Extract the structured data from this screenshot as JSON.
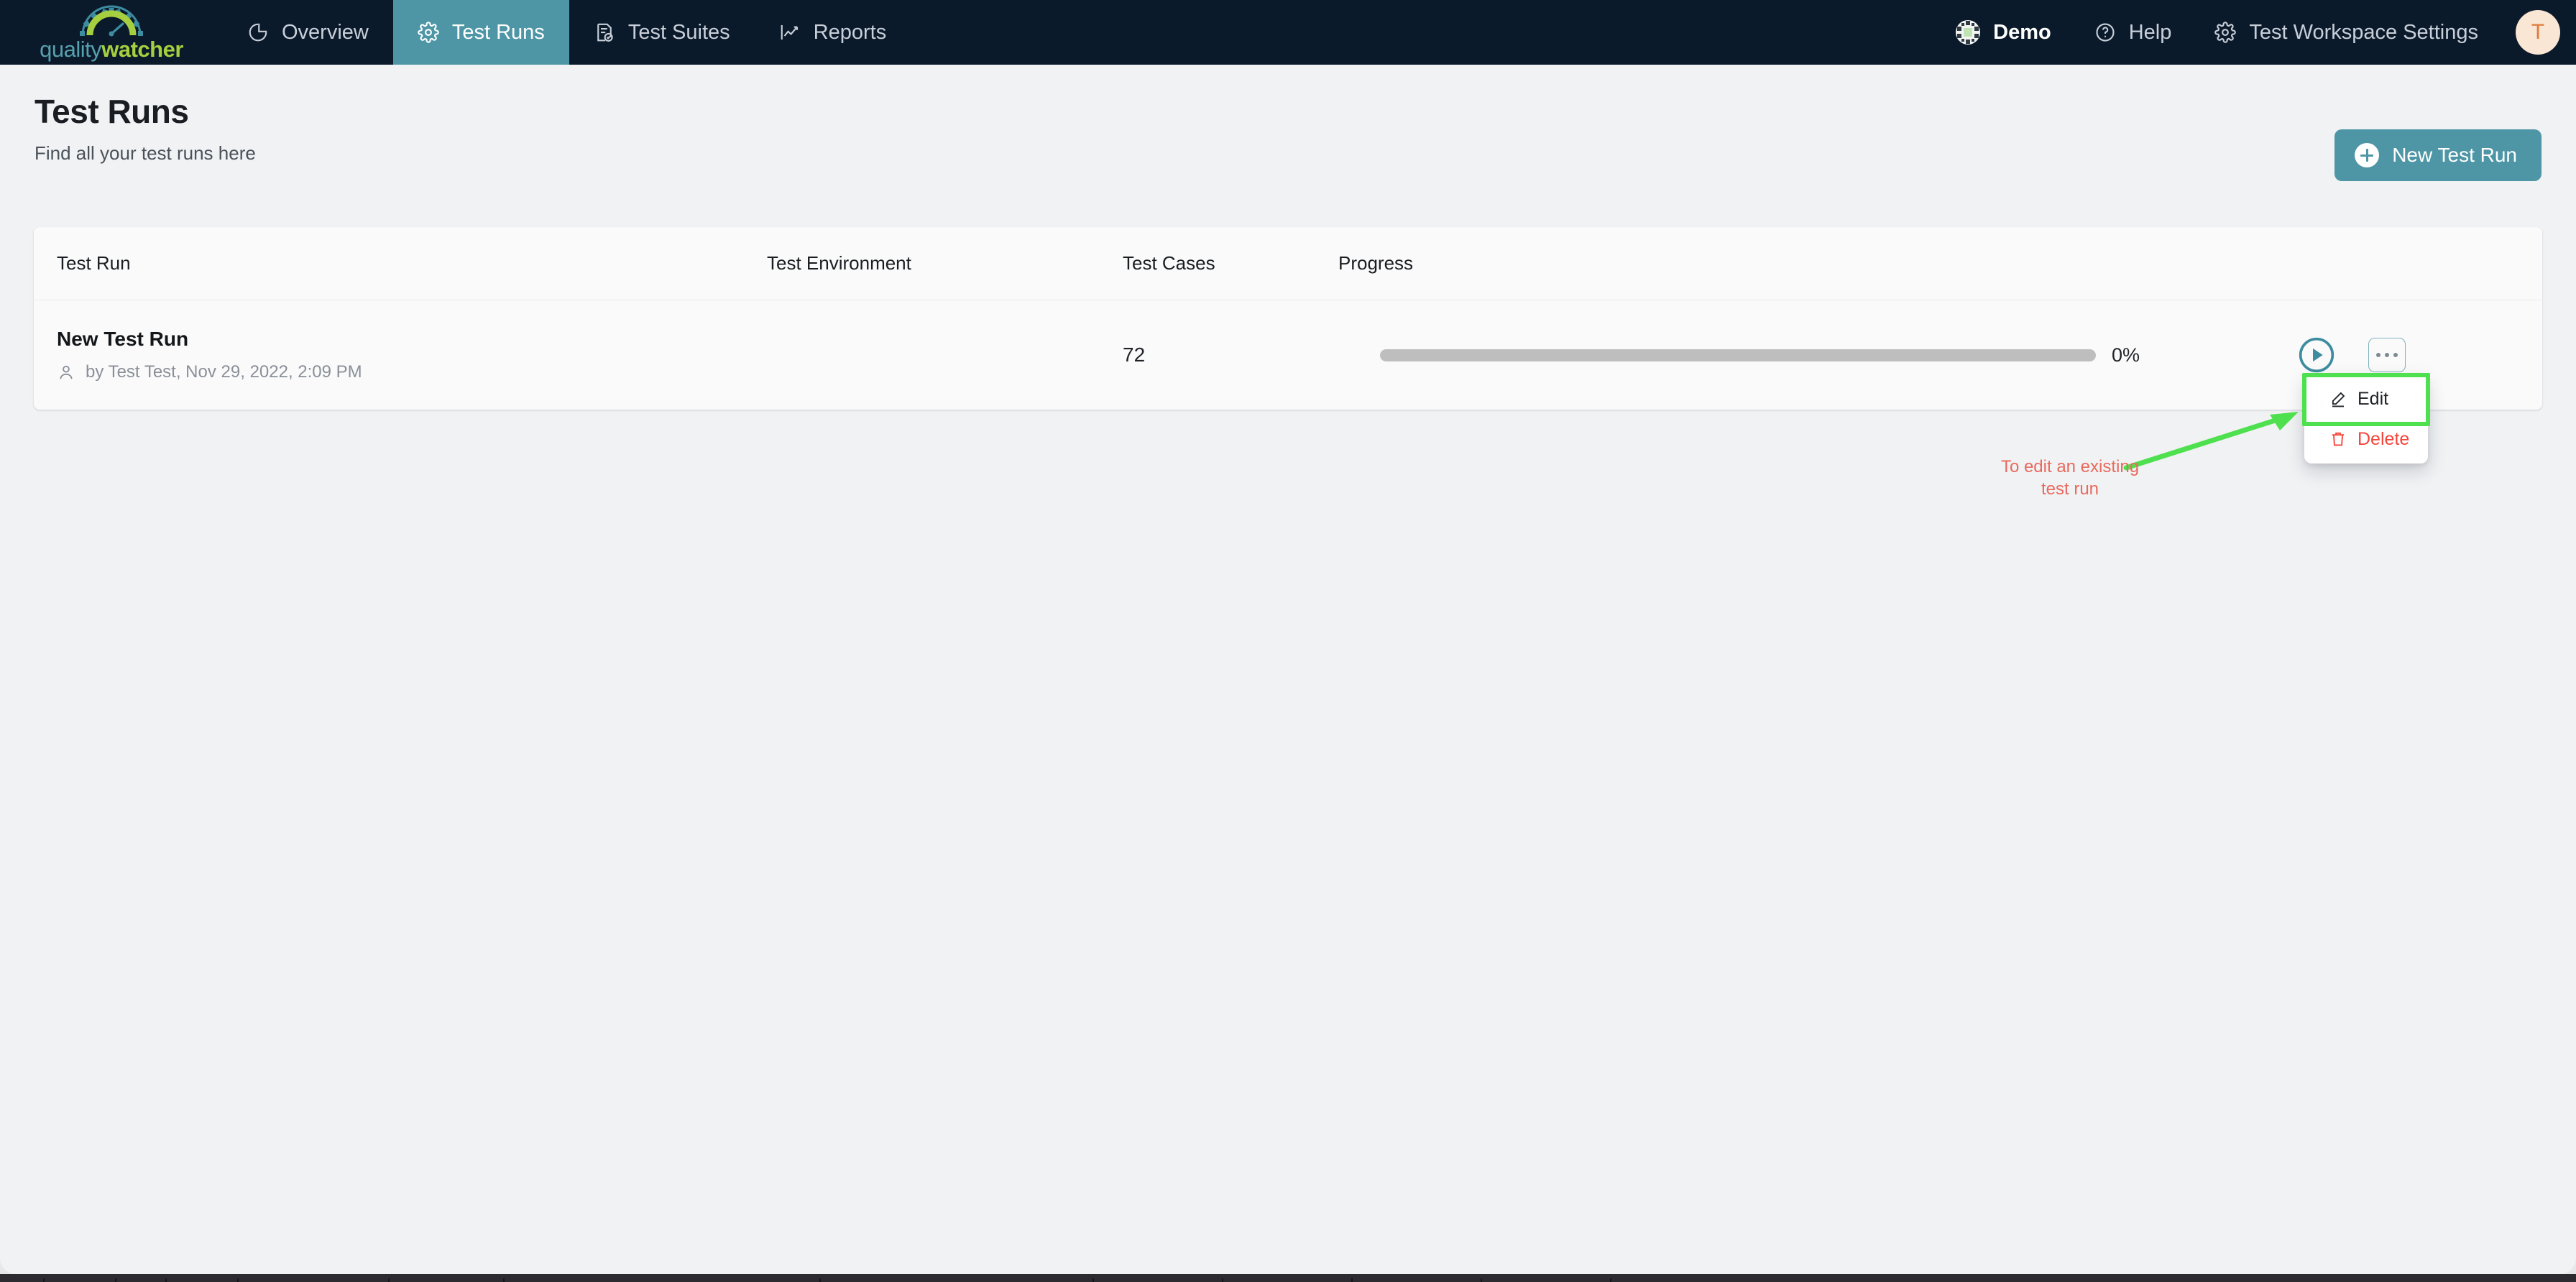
{
  "brand": {
    "logo_text_part1": "quality",
    "logo_text_part2": "watcher",
    "logo_icon": "gauge-icon",
    "teal": "#4e96a6",
    "green": "#a6cf3f",
    "navy": "#0b1a2b"
  },
  "nav": {
    "left_items": [
      {
        "label": "Overview",
        "icon": "pie-chart-icon",
        "active": false
      },
      {
        "label": "Test Runs",
        "icon": "gear-icon",
        "active": true
      },
      {
        "label": "Test Suites",
        "icon": "document-check-icon",
        "active": false
      },
      {
        "label": "Reports",
        "icon": "line-chart-icon",
        "active": false
      }
    ],
    "right_items": [
      {
        "label": "Demo",
        "icon": "workspace-identicon"
      },
      {
        "label": "Help",
        "icon": "question-circle-icon"
      },
      {
        "label": "Test Workspace Settings",
        "icon": "gear-icon"
      }
    ],
    "avatar_initial": "T",
    "avatar_bg": "#fae6d4",
    "avatar_color": "#e07b3c"
  },
  "page": {
    "title": "Test Runs",
    "subtitle": "Find all your test runs here",
    "primary_button": {
      "label": "New Test Run",
      "icon": "plus-circle-icon"
    }
  },
  "table": {
    "columns": [
      "Test Run",
      "Test Environment",
      "Test Cases",
      "Progress"
    ],
    "rows": [
      {
        "name": "New Test Run",
        "meta": "by Test Test, Nov 29, 2022, 2:09 PM",
        "meta_icon": "user-icon",
        "environment": "",
        "test_cases": "72",
        "progress_percent": 0,
        "progress_label": "0%",
        "actions": [
          "run-play-button",
          "more-options-button"
        ]
      }
    ]
  },
  "dropdown": {
    "open": true,
    "items": [
      {
        "label": "Edit",
        "icon": "pencil-icon",
        "highlighted": true,
        "color": "#1f2328"
      },
      {
        "label": "Delete",
        "icon": "trash-icon",
        "highlighted": false,
        "color": "#f4453a"
      }
    ]
  },
  "annotation": {
    "text_line1": "To edit an existing",
    "text_line2": "test run",
    "text_color": "#ea6a5e",
    "arrow_color": "#4ee04e",
    "highlight_color": "#4ee04e"
  }
}
